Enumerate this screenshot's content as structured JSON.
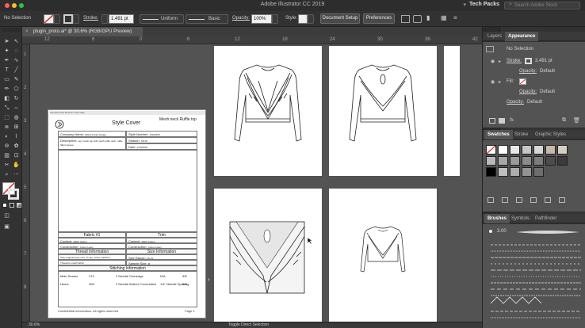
{
  "app": {
    "title": "Adobe Illustrator CC 2019",
    "workspace": "Tech Packs",
    "search_placeholder": "Search Adobe Stock"
  },
  "control_bar": {
    "selection": "No Selection",
    "stroke_label": "Stroke:",
    "stroke_value": "1.491 pt",
    "profile": "Uniform",
    "brush": "Basic",
    "opacity_label": "Opacity:",
    "opacity_value": "100%",
    "style_label": "Style:",
    "document_setup": "Document Setup",
    "preferences": "Preferences"
  },
  "document_tab": {
    "name": "plugin_proto.ai* @ 30.6% (RGB/GPU Preview)",
    "close_glyph": "×"
  },
  "rulers": {
    "h_ticks": [
      "12",
      "6",
      "0",
      "6",
      "12",
      "18",
      "24",
      "30",
      "36",
      "42"
    ],
    "v_ticks": [
      "1",
      "2",
      "3",
      "4",
      "5",
      "6",
      "7",
      "8"
    ]
  },
  "status_bar": {
    "zoom": "30.6%",
    "tool": "Toggle Direct Selection"
  },
  "panels": {
    "top_tabs": [
      "Layers",
      "Appearance"
    ],
    "appearance": {
      "header": "No Selection",
      "stroke_label": "Stroke:",
      "stroke_value": "3.491 pt",
      "stroke_opacity_label": "Opacity:",
      "stroke_opacity_value": "Default",
      "fill_label": "Fill:",
      "fill_opacity_label": "Opacity:",
      "fill_opacity_value": "Default",
      "obj_opacity_label": "Opacity:",
      "obj_opacity_value": "Default",
      "fx": "fx."
    },
    "swatch_tabs": [
      "Swatches",
      "Stroke",
      "Graphic Styles"
    ],
    "swatch_colors": [
      "#ffffff",
      "#e8e8e8",
      "#c6c6c6",
      "#d8d8d8",
      "#c9b8a8",
      "#d6cfc4",
      "#b9b9b9",
      "#a7a7a7",
      "#9a9a9a",
      "#8b8b8b",
      "#7c7c7c",
      "#4c4c4c",
      "#3a3a3a",
      "#000000",
      "#bfbfbf",
      "#adadad",
      "#939393",
      "#6e6e6e"
    ],
    "brush_tabs": [
      "Brushes",
      "Symbols",
      "Pathfinder"
    ],
    "brush_size": "3.00"
  },
  "cover": {
    "browser_text": "File Edit View Browse Tools Help",
    "title": "Style Cover",
    "style_name": "Mesh neck Ruffle top",
    "company_name_label": "Company Name:",
    "company_name_value": "NADA Pants Design",
    "description_label": "Description:",
    "description_value": "very mesh top with mesh ruffle neck, ruffle, fabric sleeve",
    "style_number_label": "Style Number:",
    "style_number_value": "10203455",
    "season_label": "Season:",
    "season_value": "SS'19",
    "date_label": "Date:",
    "date_value": "1/24/2019",
    "fabric_header": "Fabric #1",
    "trim_header": "Trim",
    "content_label": "Content:",
    "content_value": "100% Cotton",
    "construction_label": "Construction:",
    "construction_value": "Cotton Lawn",
    "trim_content_label": "Content:",
    "trim_content_value": "100% Cotton",
    "trim_construction_label": "Construction:",
    "trim_construction_value": "Cotton Lawn",
    "thread_header": "Thread Information",
    "thread_value": "Poly wrapped poly core, 2x ply, colour matched",
    "thread_match": "Thread to match fabric",
    "size_header": "Size Information",
    "size_range_label": "Size Range:",
    "size_range_value": "XS-XL",
    "sample_size_label": "Sample Size:",
    "sample_size_value": "M",
    "stitching_header": "Stitching Information",
    "stitch_rows": [
      [
        "Main Seams",
        "213",
        "2 Needle Overedge",
        "N/A",
        "3/8"
      ],
      [
        "Hems",
        "406",
        "2 Needle Bottom Coverstitch",
        "1/4\" Needle Spacing",
        "3/8"
      ]
    ],
    "footer": "Confidential information. All rights reserved",
    "page": "Page 1"
  }
}
